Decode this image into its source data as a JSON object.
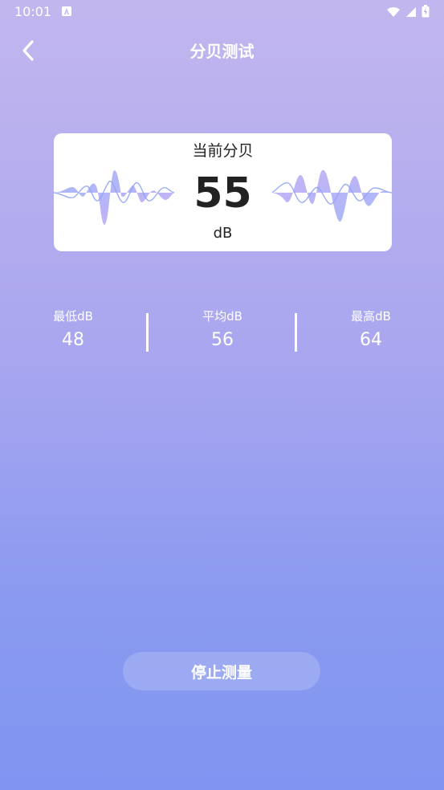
{
  "status_bar": {
    "time": "10:01"
  },
  "header": {
    "title": "分贝测试"
  },
  "meter": {
    "label": "当前分贝",
    "value": "55",
    "unit": "dB"
  },
  "stats": [
    {
      "label": "最低dB",
      "value": "48"
    },
    {
      "label": "平均dB",
      "value": "56"
    },
    {
      "label": "最高dB",
      "value": "64"
    }
  ],
  "actions": {
    "stop_label": "停止测量"
  },
  "colors": {
    "wave_blue": "#8fa4f4",
    "wave_purple": "#b7a5f2",
    "accent_text": "#222222"
  },
  "icons": {
    "back": "chevron-left-icon",
    "wifi": "wifi-icon",
    "signal": "signal-icon",
    "battery": "battery-charging-icon"
  }
}
